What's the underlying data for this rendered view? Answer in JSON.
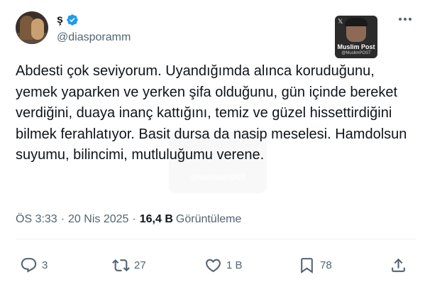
{
  "author": {
    "display_name": "ş",
    "handle": "@diasporamm",
    "verified": true
  },
  "media_badge": {
    "title": "Muslim Post",
    "subtitle": "@MuslimPOST",
    "icon": "x-logo"
  },
  "watermark": {
    "text": "@MuslimPOST"
  },
  "tweet": {
    "text": "Abdesti çok seviyorum. Uyandığımda alınca koruduğunu, yemek yaparken ve yerken şifa olduğunu, gün içinde bereket verdiğini, duaya inanç kattığını, temiz ve güzel hissettirdiğini bilmek ferahlatıyor. Basit dursa da nasip meselesi. Hamdolsun suyumu, bilincimi, mutluluğumu verene."
  },
  "meta": {
    "time": "ÖS 3:33",
    "date": "20 Nis 2025",
    "separator": "·",
    "views_count": "16,4 B",
    "views_label": "Görüntüleme"
  },
  "actions": {
    "reply_count": "3",
    "retweet_count": "27",
    "like_count": "1 B",
    "bookmark_count": "78"
  },
  "colors": {
    "verified_blue": "#1d9bf0",
    "text_primary": "#0f1419",
    "text_secondary": "#536471"
  }
}
